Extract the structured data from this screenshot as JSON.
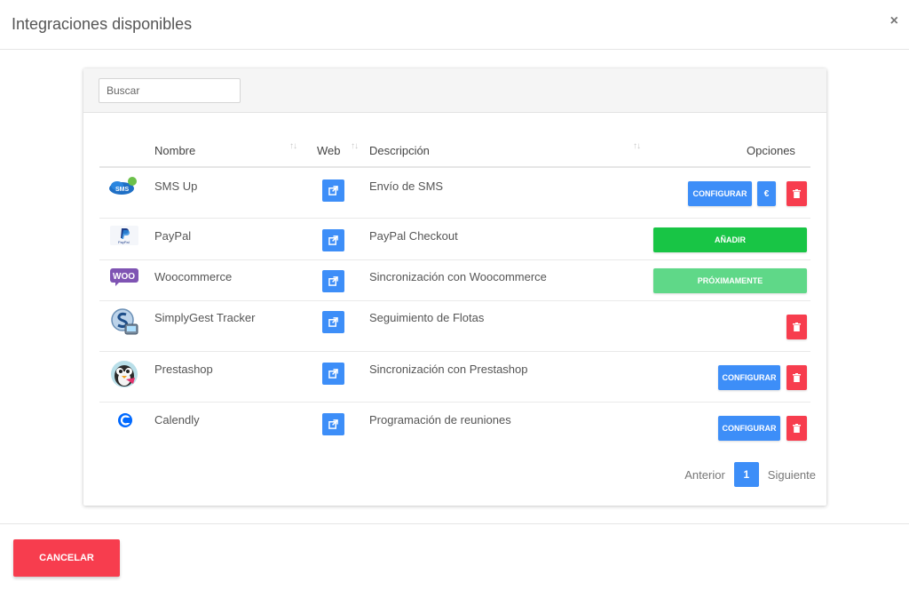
{
  "modal": {
    "title": "Integraciones disponibles",
    "close_label": "×"
  },
  "search": {
    "placeholder": "Buscar",
    "value": ""
  },
  "table": {
    "columns": {
      "nombre": "Nombre",
      "web": "Web",
      "descripcion": "Descripción",
      "opciones": "Opciones"
    },
    "sort_glyph": "↑↓",
    "rows": [
      {
        "logo": "sms-up-logo",
        "logo_text": "SMS",
        "name": "SMS Up",
        "description": "Envío de SMS",
        "actions": {
          "configure": "CONFIGURAR",
          "currency": "€"
        }
      },
      {
        "logo": "paypal-logo",
        "logo_text": "PayPal",
        "name": "PayPal",
        "description": "PayPal Checkout",
        "actions": {
          "add": "AÑADIR"
        }
      },
      {
        "logo": "woocommerce-logo",
        "logo_text": "WOO",
        "name": "Woocommerce",
        "description": "Sincronización con Woocommerce",
        "actions": {
          "coming_soon": "PRÓXIMAMENTE"
        }
      },
      {
        "logo": "simplygest-logo",
        "name": "SimplyGest Tracker",
        "description": "Seguimiento de Flotas",
        "actions": {}
      },
      {
        "logo": "prestashop-logo",
        "name": "Prestashop",
        "description": "Sincronización con Prestashop",
        "actions": {
          "configure": "CONFIGURAR"
        }
      },
      {
        "logo": "calendly-logo",
        "name": "Calendly",
        "description": "Programación de reuniones",
        "actions": {
          "configure": "CONFIGURAR"
        }
      }
    ]
  },
  "pagination": {
    "prev": "Anterior",
    "current": "1",
    "next": "Siguiente"
  },
  "footer": {
    "cancel_label": "CANCELAR"
  },
  "colors": {
    "primary": "#3d8ef8",
    "danger": "#f73d4e",
    "success": "#18c545",
    "success_light": "#5fd888"
  },
  "icons": {
    "web": "external-link-icon",
    "delete": "trash-icon",
    "close": "close-icon"
  }
}
